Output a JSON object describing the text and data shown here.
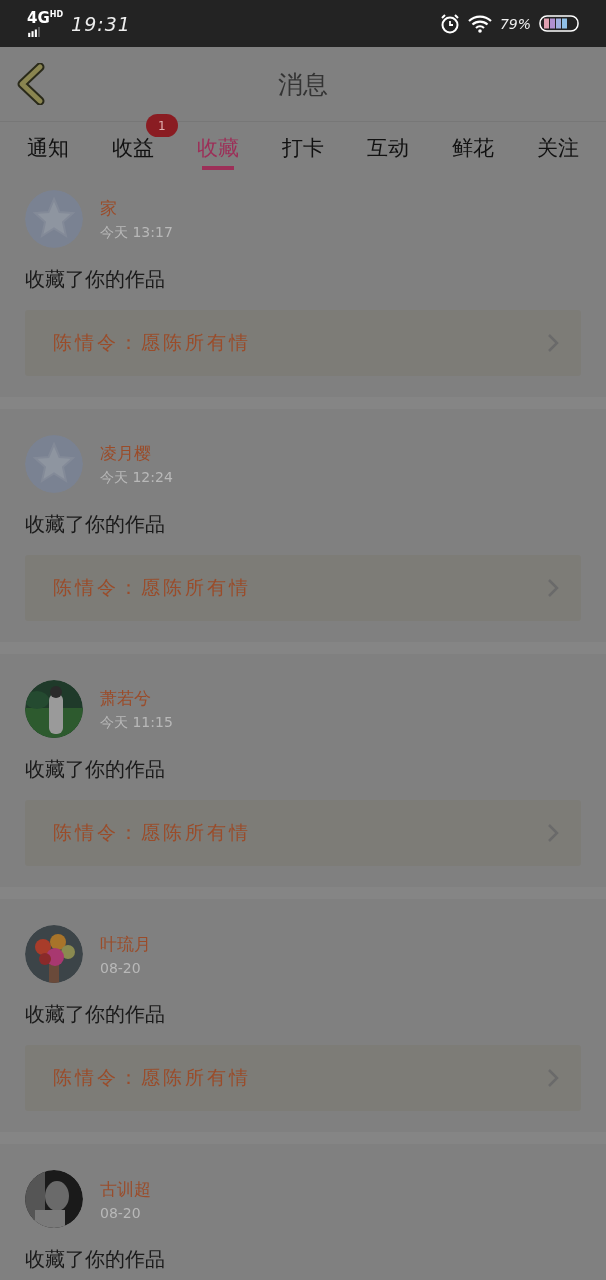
{
  "status_bar": {
    "network": "4G",
    "network_sup": "HD",
    "time": "19:31",
    "battery_text": "79%"
  },
  "header": {
    "title": "消息"
  },
  "tabs": [
    {
      "label": "通知",
      "selected": false
    },
    {
      "label": "收益",
      "selected": false,
      "badge": "1"
    },
    {
      "label": "收藏",
      "selected": true
    },
    {
      "label": "打卡",
      "selected": false
    },
    {
      "label": "互动",
      "selected": false
    },
    {
      "label": "鲜花",
      "selected": false
    },
    {
      "label": "关注",
      "selected": false
    }
  ],
  "messages": [
    {
      "kind": "default",
      "name": "家",
      "time": "今天 13:17",
      "text": "收藏了你的作品",
      "work": "陈情令：愿陈所有情"
    },
    {
      "kind": "default",
      "name": "凌月樱",
      "time": "今天 12:24",
      "text": "收藏了你的作品",
      "work": "陈情令：愿陈所有情"
    },
    {
      "kind": "picture",
      "name": "萧若兮",
      "time": "今天 11:15",
      "text": "收藏了你的作品",
      "work": "陈情令：愿陈所有情"
    },
    {
      "kind": "picture",
      "name": "叶琉月",
      "time": "08-20",
      "text": "收藏了你的作品",
      "work": "陈情令：愿陈所有情"
    },
    {
      "kind": "picture",
      "name": "古训超",
      "time": "08-20",
      "text": "收藏了你的作品"
    }
  ]
}
